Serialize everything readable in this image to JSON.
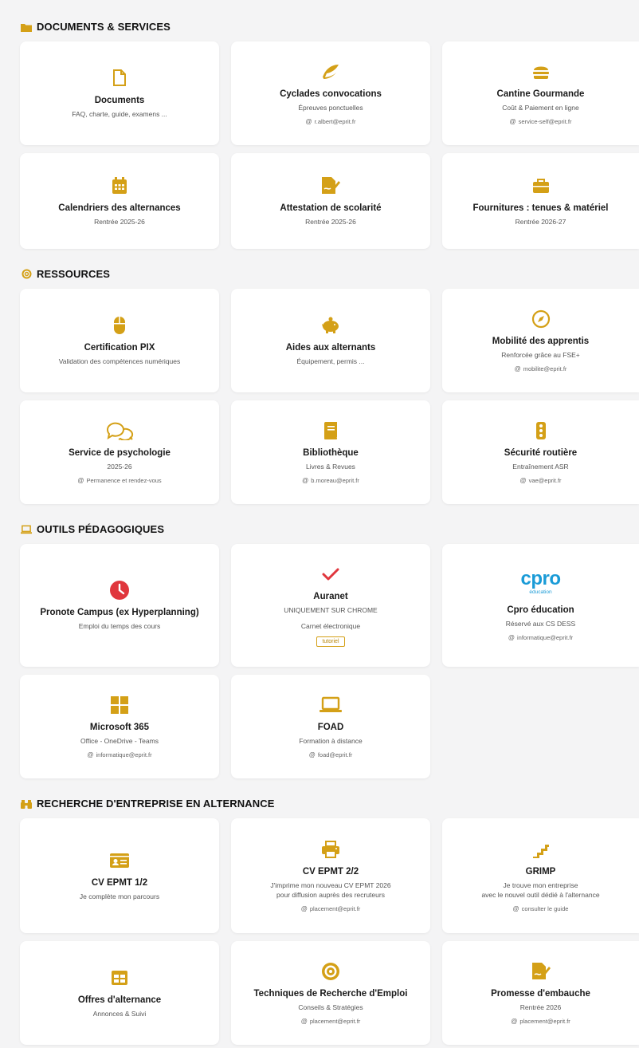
{
  "colors": {
    "accent": "#d4a017",
    "pronote": "#e0363d",
    "auranet": "#e0363d",
    "cpro": "#1a9bd7"
  },
  "sections": {
    "docs": {
      "title": "DOCUMENTS & SERVICES",
      "icon": "folder-icon",
      "cards": [
        {
          "icon": "file-icon",
          "title": "Documents",
          "sub": "FAQ, charte, guide, examens ..."
        },
        {
          "icon": "feather-icon",
          "title": "Cyclades convocations",
          "sub": "Épreuves ponctuelles",
          "email": "r.albert@eprit.fr"
        },
        {
          "icon": "burger-icon",
          "title": "Cantine Gourmande",
          "sub": "Coût & Paiement en ligne",
          "email": "service-self@eprit.fr"
        },
        {
          "icon": "calendar-icon",
          "title": "Calendriers des alternances",
          "sub": "Rentrée 2025-26"
        },
        {
          "icon": "signature-icon",
          "title": "Attestation de scolarité",
          "sub": "Rentrée 2025-26"
        },
        {
          "icon": "briefcase-icon",
          "title": "Fournitures : tenues & matériel",
          "sub": "Rentrée 2026-27"
        }
      ]
    },
    "res": {
      "title": "RESSOURCES",
      "icon": "lifebuoy-icon",
      "cards": [
        {
          "icon": "mouse-icon",
          "title": "Certification PIX",
          "sub": "Validation des compétences numériques"
        },
        {
          "icon": "piggy-bank-icon",
          "title": "Aides aux alternants",
          "sub": "Équipement, permis ..."
        },
        {
          "icon": "compass-icon",
          "title": "Mobilité des apprentis",
          "sub": "Renforcée grâce au FSE+",
          "email": "mobilite@eprit.fr"
        },
        {
          "icon": "chat-icon",
          "title": "Service de psychologie",
          "sub": "2025-26",
          "email": "Permanence et rendez-vous"
        },
        {
          "icon": "book-icon",
          "title": "Bibliothèque",
          "sub": "Livres & Revues",
          "email": "b.moreau@eprit.fr"
        },
        {
          "icon": "traffic-light-icon",
          "title": "Sécurité routière",
          "sub": "Entraînement ASR",
          "email": "vae@eprit.fr"
        }
      ]
    },
    "tools": {
      "title": "OUTILS PÉDAGOGIQUES",
      "icon": "laptop-icon",
      "cards": [
        {
          "icon": "clock-icon",
          "title": "Pronote Campus (ex Hyperplanning)",
          "sub": "Emploi du temps des cours"
        },
        {
          "icon": "check-icon",
          "title": "Auranet",
          "sub": "UNIQUEMENT SUR CHROME",
          "sub2": "Carnet électronique",
          "tag": "tutoriel"
        },
        {
          "icon": "cpro-logo",
          "logo_text": "cpro",
          "logo_sub": "éducation",
          "title": "Cpro éducation",
          "sub": "Réservé aux CS DESS",
          "email": "informatique@eprit.fr"
        },
        {
          "icon": "windows-icon",
          "title": "Microsoft 365",
          "sub": "Office - OneDrive - Teams",
          "email": "informatique@eprit.fr"
        },
        {
          "icon": "laptop-icon",
          "title": "FOAD",
          "sub": "Formation à distance",
          "email": "foad@eprit.fr"
        }
      ]
    },
    "jobs": {
      "title": "RECHERCHE D'ENTREPRISE EN ALTERNANCE",
      "icon": "binoculars-icon",
      "cards": [
        {
          "icon": "id-card-icon",
          "title": "CV EPMT 1/2",
          "sub": "Je complète mon parcours"
        },
        {
          "icon": "printer-icon",
          "title": "CV EPMT 2/2",
          "sub": "J'imprime mon nouveau CV EPMT 2026",
          "sub2": "pour diffusion auprès des recruteurs",
          "email": "placement@eprit.fr"
        },
        {
          "icon": "stairs-icon",
          "title": "GRIMP",
          "sub": "Je trouve mon entreprise",
          "sub2": "avec le nouvel outil dédié à l'alternance",
          "email": "consulter le guide"
        },
        {
          "icon": "table-icon",
          "title": "Offres d'alternance",
          "sub": "Annonces & Suivi"
        },
        {
          "icon": "target-icon",
          "title": "Techniques de Recherche d'Emploi",
          "sub": "Conseils & Stratégies",
          "email": "placement@eprit.fr"
        },
        {
          "icon": "signature-icon",
          "title": "Promesse d'embauche",
          "sub": "Rentrée 2026",
          "email": "placement@eprit.fr"
        }
      ]
    }
  }
}
